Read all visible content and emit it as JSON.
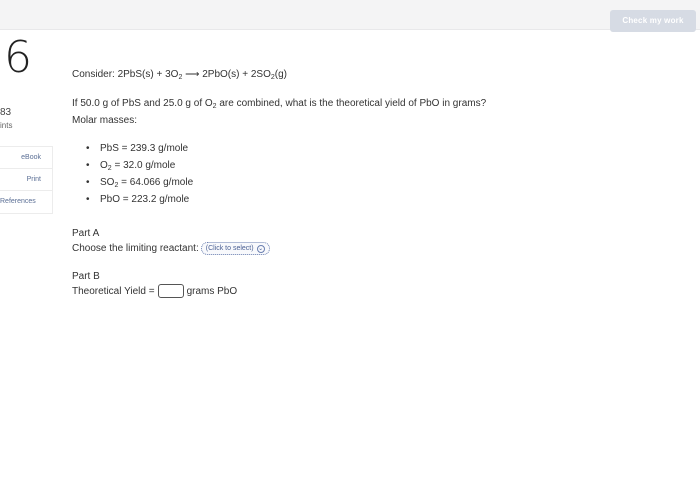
{
  "header": {
    "check_button": "Check my work"
  },
  "sidebar": {
    "question_number": "6",
    "points_value": "83",
    "points_label": "ints",
    "buttons": [
      "eBook",
      "Print",
      "References"
    ]
  },
  "question": {
    "consider_prefix": "Consider: 2PbS(s) + 3O",
    "consider_sub1": "2",
    "consider_mid": " ⟶ 2PbO(s) + 2SO",
    "consider_sub2": "2",
    "consider_suffix": "(g)",
    "prompt_prefix": "If 50.0 g of PbS and 25.0 g of O",
    "prompt_sub": "2",
    "prompt_suffix": " are combined, what is the theoretical yield of PbO in grams?",
    "molar_masses_label": "Molar masses:",
    "masses": [
      {
        "pre": "PbS",
        "sub": "",
        "post": " = 239.3 g/mole"
      },
      {
        "pre": "O",
        "sub": "2",
        "post": " = 32.0 g/mole"
      },
      {
        "pre": "SO",
        "sub": "2",
        "post": " = 64.066 g/mole"
      },
      {
        "pre": "PbO",
        "sub": "",
        "post": " = 223.2 g/mole"
      }
    ]
  },
  "partA": {
    "label": "Part A",
    "prompt": "Choose the limiting reactant:",
    "select_placeholder": "(Click to select)",
    "select_icon": "chevron-circle-icon"
  },
  "partB": {
    "label": "Part B",
    "prompt": "Theoretical Yield =",
    "input_value": "",
    "unit": "grams PbO"
  }
}
